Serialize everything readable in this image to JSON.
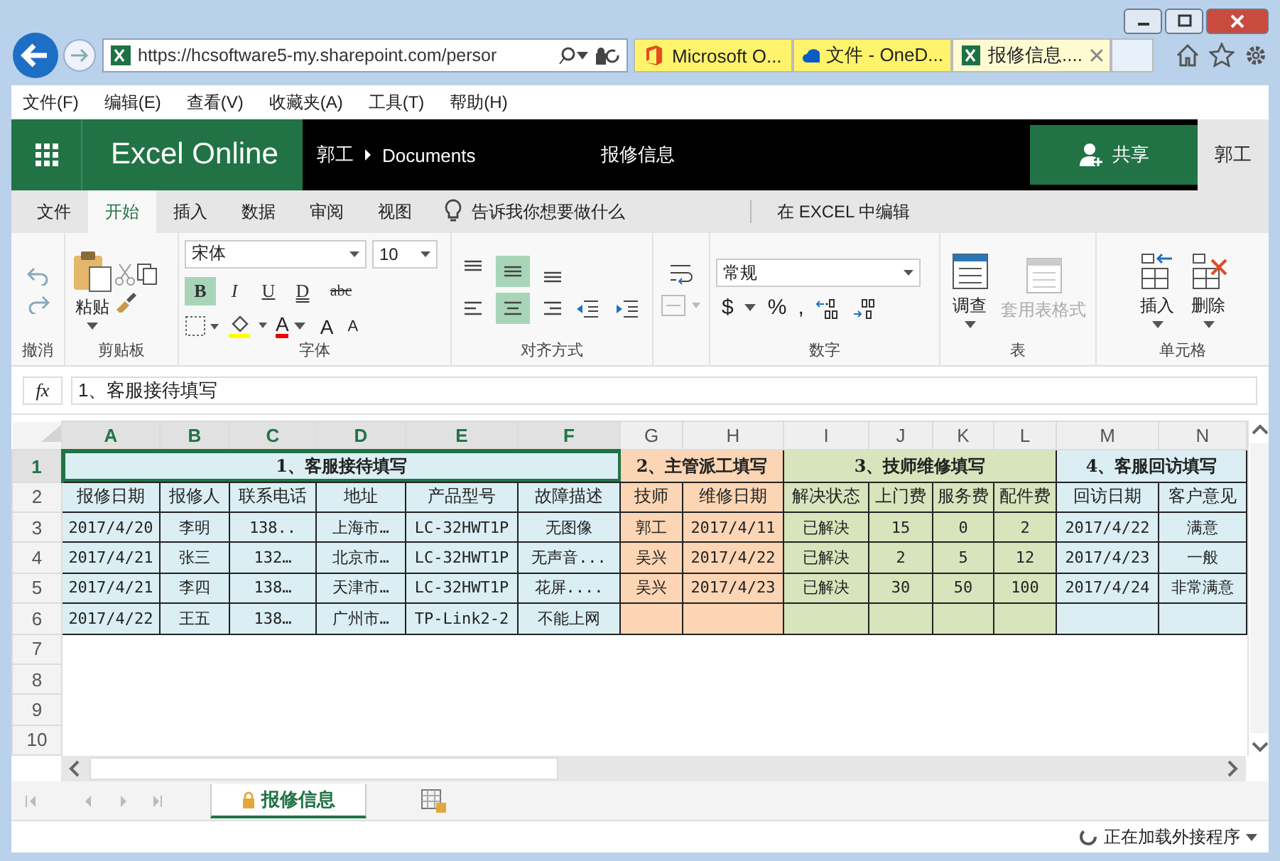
{
  "browser": {
    "address": "https://hcsoftware5-my.sharepoint.com/persor",
    "tabs": [
      {
        "title": "Microsoft O...",
        "kind": "office",
        "selected": false
      },
      {
        "title": "文件 - OneD...",
        "kind": "cloud",
        "selected": false
      },
      {
        "title": "报修信息....",
        "kind": "excel",
        "selected": true
      }
    ],
    "menu": [
      "文件(F)",
      "编辑(E)",
      "查看(V)",
      "收藏夹(A)",
      "工具(T)",
      "帮助(H)"
    ]
  },
  "app_header": {
    "app_name": "Excel Online",
    "breadcrumb": [
      "郭工",
      "Documents"
    ],
    "file_title": "报修信息",
    "share_button": "共享",
    "user": "郭工"
  },
  "ribbon_tabs": [
    {
      "label": "文件",
      "selected": false
    },
    {
      "label": "开始",
      "selected": true
    },
    {
      "label": "插入",
      "selected": false
    },
    {
      "label": "数据",
      "selected": false
    },
    {
      "label": "审阅",
      "selected": false
    },
    {
      "label": "视图",
      "selected": false
    }
  ],
  "tell_me": "告诉我你想要做什么",
  "edit_in_excel": "在 EXCEL 中编辑",
  "ribbon": {
    "groups": [
      "撤消",
      "剪贴板",
      "字体",
      "对齐方式",
      "数字",
      "表",
      "单元格"
    ],
    "paste": "粘贴",
    "font_name": "宋体",
    "font_size": "10",
    "format_buttons": [
      {
        "label": "B",
        "selected": true
      },
      {
        "label": "I",
        "selected": false
      },
      {
        "label": "U",
        "selected": false
      },
      {
        "label": "D",
        "selected": false
      },
      {
        "label": "abc",
        "selected": false
      }
    ],
    "font_color_label": "A",
    "size_buttons": [
      "A",
      "A"
    ],
    "alignment": [
      {
        "kind": "top",
        "selected": false
      },
      {
        "kind": "middle",
        "selected": true
      },
      {
        "kind": "bottom",
        "selected": false
      },
      {
        "kind": "left",
        "selected": false
      },
      {
        "kind": "center",
        "selected": true
      },
      {
        "kind": "right",
        "selected": false
      }
    ],
    "number_format": "常规",
    "number_buttons": [
      "$",
      "%",
      ","
    ],
    "table_buttons": [
      {
        "label": "调查",
        "disabled": false
      },
      {
        "label": "套用表格式",
        "disabled": true
      }
    ],
    "cell_buttons": [
      {
        "label": "插入",
        "kind": "insert"
      },
      {
        "label": "删除",
        "kind": "delete"
      }
    ]
  },
  "formula_bar": {
    "fx": "fx",
    "value": "1、客服接待填写"
  },
  "sheet": {
    "column_letters": [
      "A",
      "B",
      "C",
      "D",
      "E",
      "F",
      "G",
      "H",
      "I",
      "J",
      "K",
      "L",
      "M",
      "N"
    ],
    "row_numbers": [
      "1",
      "2",
      "3",
      "4",
      "5",
      "6",
      "7",
      "8",
      "9",
      "10"
    ],
    "groups": [
      {
        "title": "1、客服接待填写",
        "color": "#daeef3",
        "selected": true,
        "headers": [
          "报修日期",
          "报修人",
          "联系电话",
          "地址",
          "产品型号",
          "故障描述"
        ]
      },
      {
        "title": "2、主管派工填写",
        "color": "#fcd5b4",
        "selected": false,
        "headers": [
          "技师",
          "维修日期"
        ]
      },
      {
        "title": "3、技师维修填写",
        "color": "#d8e4bc",
        "selected": false,
        "headers": [
          "解决状态",
          "上门费",
          "服务费",
          "配件费"
        ]
      },
      {
        "title": "4、客服回访填写",
        "color": "#daeef3",
        "selected": false,
        "headers": [
          "回访日期",
          "客户意见"
        ]
      }
    ],
    "rows": [
      [
        "2017/4/20",
        "李明",
        "138..",
        "上海市…",
        "LC-32HWT1P",
        "无图像",
        "郭工",
        "2017/4/11",
        "已解决",
        "15",
        "0",
        "2",
        "2017/4/22",
        "满意"
      ],
      [
        "2017/4/21",
        "张三",
        "132…",
        "北京市…",
        "LC-32HWT1P",
        "无声音...",
        "吴兴",
        "2017/4/22",
        "已解决",
        "2",
        "5",
        "12",
        "2017/4/23",
        "一般"
      ],
      [
        "2017/4/21",
        "李四",
        "138…",
        "天津市…",
        "LC-32HWT1P",
        "花屏....",
        "吴兴",
        "2017/4/23",
        "已解决",
        "30",
        "50",
        "100",
        "2017/4/24",
        "非常满意"
      ],
      [
        "2017/4/22",
        "王五",
        "138…",
        "广州市…",
        "TP-Link2-2",
        "不能上网"
      ]
    ]
  },
  "sheet_tabs": [
    {
      "label": "报修信息",
      "selected": true,
      "locked": true
    }
  ],
  "status_bar": "正在加载外接程序"
}
